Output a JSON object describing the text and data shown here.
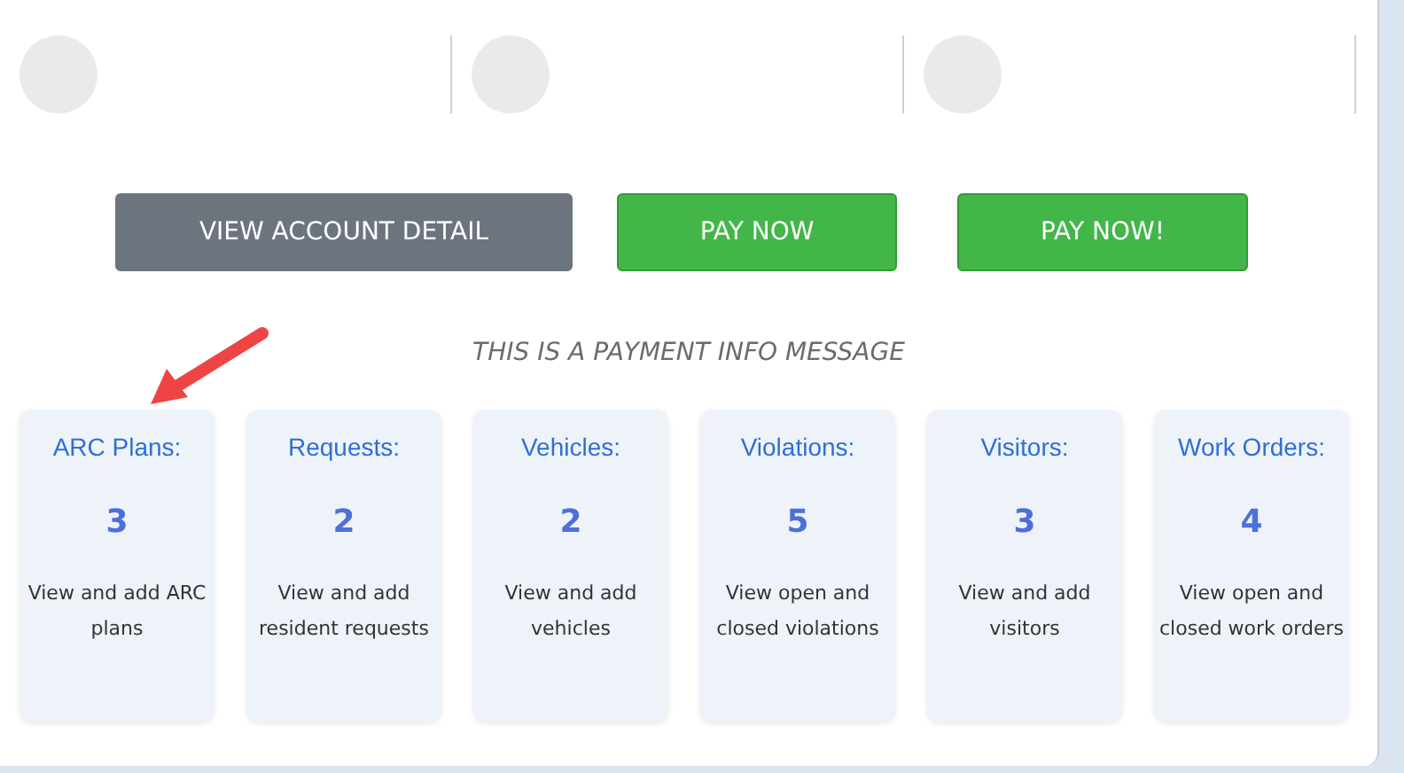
{
  "profile_slots": [
    {
      "kind": "avatar"
    },
    {
      "kind": "avatar"
    },
    {
      "kind": "avatar"
    }
  ],
  "buttons": [
    {
      "label": "VIEW ACCOUNT DETAIL",
      "kind": "secondary"
    },
    {
      "label": "PAY NOW",
      "kind": "success"
    },
    {
      "label": "PAY NOW!",
      "kind": "success"
    }
  ],
  "payment_message": "THIS IS A PAYMENT INFO MESSAGE",
  "cards": [
    {
      "title": "ARC Plans:",
      "count": "3",
      "description": "View and add ARC plans"
    },
    {
      "title": "Requests:",
      "count": "2",
      "description": "View and add resident requests"
    },
    {
      "title": "Vehicles:",
      "count": "2",
      "description": "View and add vehicles"
    },
    {
      "title": "Violations:",
      "count": "5",
      "description": "View open and closed violations"
    },
    {
      "title": "Visitors:",
      "count": "3",
      "description": "View and add visitors"
    },
    {
      "title": "Work Orders:",
      "count": "4",
      "description": "View open and closed work orders"
    }
  ]
}
